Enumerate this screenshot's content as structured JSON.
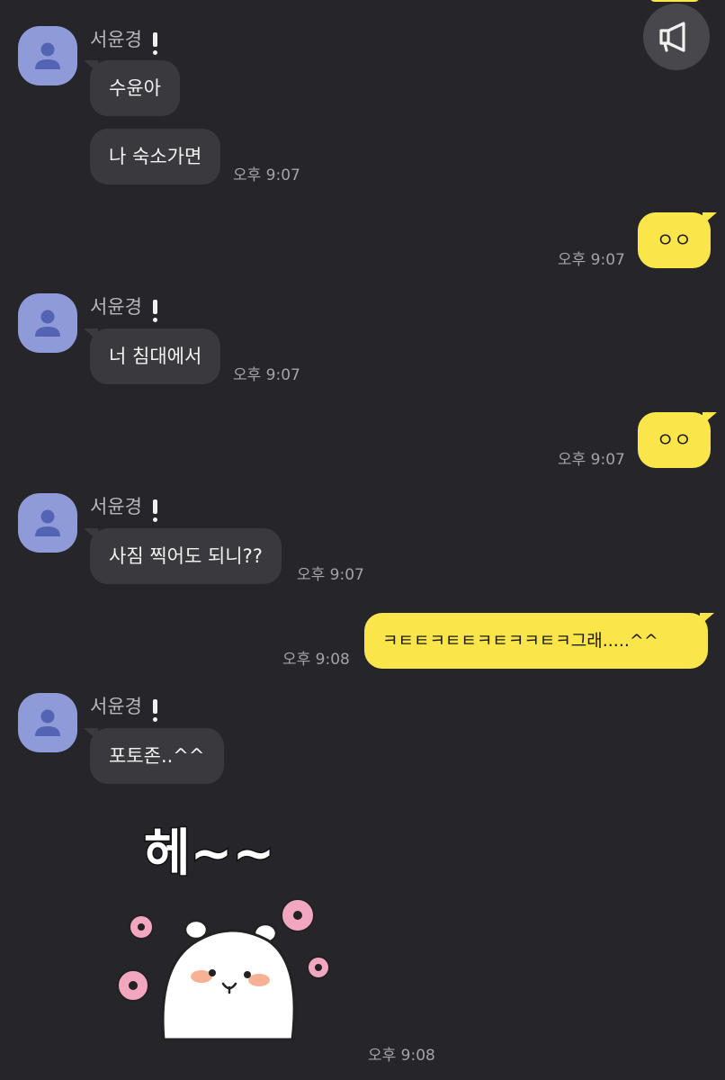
{
  "sender_name": "서윤경",
  "messages": {
    "m1": "수윤아",
    "m2": "나 숙소가면",
    "m3": "ㅇㅇ",
    "m4": "너 침대에서",
    "m5": "ㅇㅇ",
    "m6": "사짐 찍어도 되니??",
    "m7": "ㅋㅌㅌㅋㅌㅌㅋㅌㅋㅋㅌㅋ그래.....^^",
    "m8": "포토존..^^"
  },
  "times": {
    "t1": "오후 9:07",
    "t2": "오후 9:07",
    "t3": "오후 9:07",
    "t4": "오후 9:07",
    "t5": "오후 9:07",
    "t6": "오후 9:08",
    "t7": "오후 9:08"
  },
  "sticker": {
    "text": "헤~~"
  },
  "colors": {
    "background": "#25252a",
    "incoming_bubble": "#3a3a3e",
    "outgoing_bubble": "#fae54a",
    "avatar": "#8e9bd8"
  },
  "icons": {
    "announcement": "megaphone-icon",
    "avatar": "person-icon"
  }
}
